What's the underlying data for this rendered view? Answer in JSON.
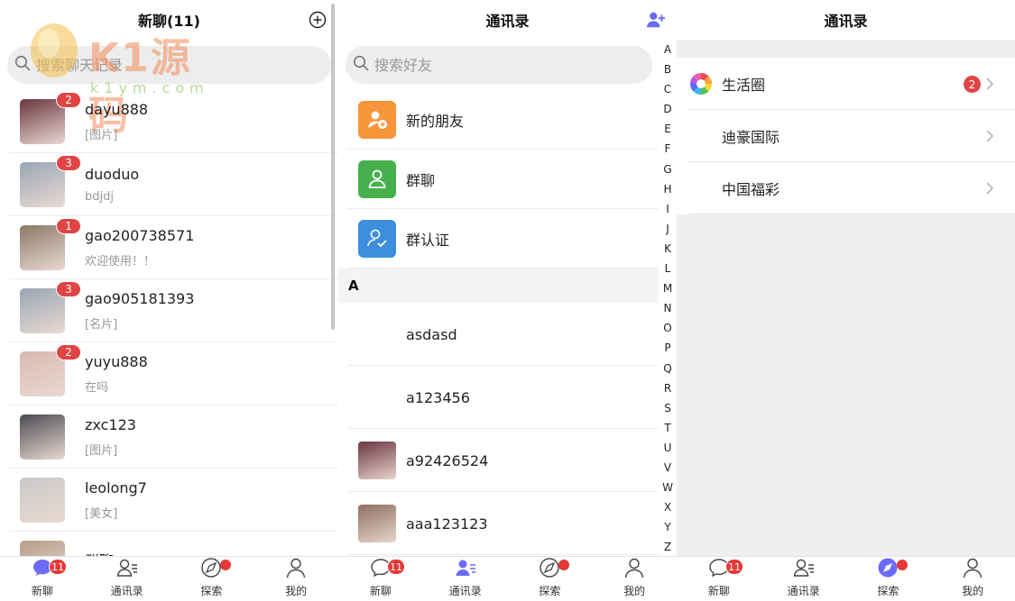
{
  "colors": {
    "accent": "#6b6bf5",
    "badge": "#e04545",
    "tab_active": "#6b6bf5"
  },
  "panel1": {
    "title": "新聊(11)",
    "search_placeholder": "搜索聊天记录",
    "chats": [
      {
        "name": "dayu888",
        "msg": "[图片]",
        "badge": "2",
        "avatar_color": "#6a3540"
      },
      {
        "name": "duoduo",
        "msg": "bdjdj",
        "badge": "3",
        "avatar_color": "#9aa7b5"
      },
      {
        "name": "gao200738571",
        "msg": "欢迎使用！！",
        "badge": "1",
        "avatar_color": "#8b7a68"
      },
      {
        "name": "gao905181393",
        "msg": "[名片]",
        "badge": "3",
        "avatar_color": "#9aa7b5"
      },
      {
        "name": "yuyu888",
        "msg": "在吗",
        "badge": "2",
        "avatar_color": "#d9b9b0"
      },
      {
        "name": "zxc123",
        "msg": "[图片]",
        "badge": "",
        "avatar_color": "#4c4b52"
      },
      {
        "name": "leolong7",
        "msg": "[美女]",
        "badge": "",
        "avatar_color": "#c9c9c9"
      },
      {
        "name": "群聊",
        "msg": "",
        "badge": "",
        "avatar_color": "#b59e88"
      }
    ]
  },
  "panel2": {
    "title": "通讯录",
    "search_placeholder": "搜索好友",
    "functions": [
      {
        "label": "新的朋友",
        "color": "#f6963a",
        "icon": "add-friend-icon"
      },
      {
        "label": "群聊",
        "color": "#46b04c",
        "icon": "group-chat-icon"
      },
      {
        "label": "群认证",
        "color": "#3d8fde",
        "icon": "group-verify-icon"
      }
    ],
    "section": "A",
    "contacts": [
      {
        "name": "asdasd",
        "avatar_color": ""
      },
      {
        "name": "a123456",
        "avatar_color": ""
      },
      {
        "name": "a92426524",
        "avatar_color": "#6a3540"
      },
      {
        "name": "aaa123123",
        "avatar_color": "#8e7060"
      }
    ],
    "alphabet": [
      "A",
      "B",
      "C",
      "D",
      "E",
      "F",
      "G",
      "H",
      "I",
      "J",
      "K",
      "L",
      "M",
      "N",
      "O",
      "P",
      "Q",
      "R",
      "S",
      "T",
      "U",
      "V",
      "W",
      "X",
      "Y",
      "Z"
    ]
  },
  "panel3": {
    "title": "通讯录",
    "items": [
      {
        "label": "生活圈",
        "badge": "2",
        "icon": "moments-icon"
      },
      {
        "label": "迪豪国际",
        "badge": "",
        "icon": ""
      },
      {
        "label": "中国福彩",
        "badge": "",
        "icon": ""
      }
    ]
  },
  "tabs": {
    "labels": [
      "新聊",
      "通讯录",
      "探索",
      "我的"
    ],
    "chat_badge": "11"
  },
  "watermark": {
    "text": "K1源码",
    "sub": "k1ym.com"
  }
}
